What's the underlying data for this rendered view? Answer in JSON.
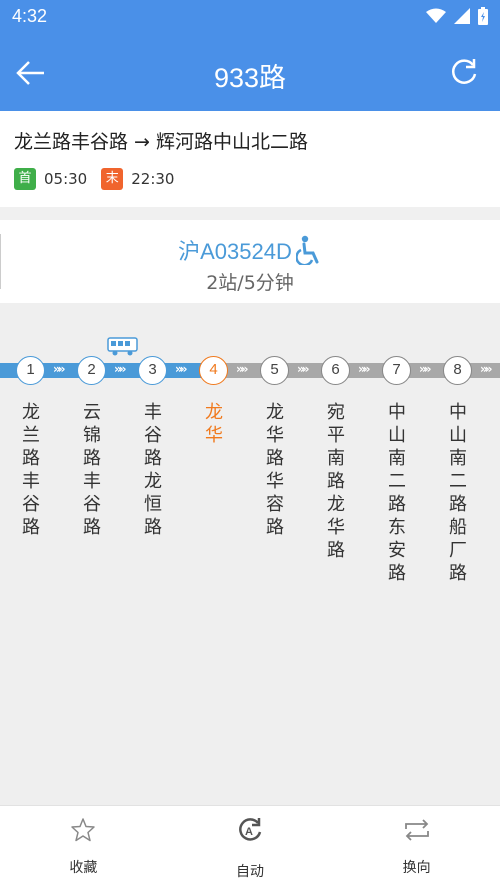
{
  "status_bar": {
    "time": "4:32"
  },
  "header": {
    "title": "933路"
  },
  "route_info": {
    "direction": "龙兰路丰谷路 → 辉河路中山北二路",
    "first_label": "首",
    "first_time": "05:30",
    "last_label": "末",
    "last_time": "22:30"
  },
  "bus": {
    "plate": "沪A03524D",
    "eta": "2站/5分钟"
  },
  "stops": [
    {
      "num": "1",
      "name": "龙兰路丰谷路",
      "status": "passed"
    },
    {
      "num": "2",
      "name": "云锦路丰谷路",
      "status": "passed"
    },
    {
      "num": "3",
      "name": "丰谷路龙恒路",
      "status": "passed"
    },
    {
      "num": "4",
      "name": "龙华",
      "status": "current"
    },
    {
      "num": "5",
      "name": "龙华路华容路",
      "status": "upcoming"
    },
    {
      "num": "6",
      "name": "宛平南路龙华路",
      "status": "upcoming"
    },
    {
      "num": "7",
      "name": "中山南二路东安路",
      "status": "upcoming"
    },
    {
      "num": "8",
      "name": "中山南二路船厂路",
      "status": "upcoming"
    }
  ],
  "bottom_nav": {
    "favorite": "收藏",
    "auto": "自动",
    "switch": "换向"
  },
  "colors": {
    "header": "#4a90e8",
    "passed": "#4a9ad8",
    "current": "#f07a1e",
    "first": "#3fae49",
    "last": "#f0642d"
  }
}
